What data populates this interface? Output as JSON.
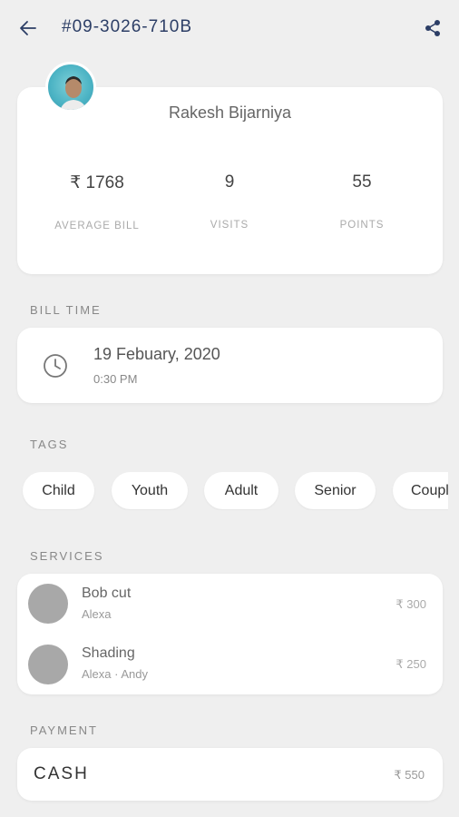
{
  "header": {
    "order_id": "#09-3026-710B"
  },
  "customer": {
    "name": "Rakesh Bijarniya",
    "stats": [
      {
        "value": "₹ 1768",
        "label": "AVERAGE BILL"
      },
      {
        "value": "9",
        "label": "VISITS"
      },
      {
        "value": "55",
        "label": "POINTS"
      }
    ]
  },
  "bill_time": {
    "section_label": "BILL TIME",
    "date": "19 Febuary, 2020",
    "time": "0:30 PM"
  },
  "tags": {
    "section_label": "TAGS",
    "items": [
      "Child",
      "Youth",
      "Adult",
      "Senior",
      "Couple"
    ]
  },
  "services": {
    "section_label": "SERVICES",
    "items": [
      {
        "name": "Bob cut",
        "staff": "Alexa",
        "price": "₹ 300"
      },
      {
        "name": "Shading",
        "staff": "Alexa · Andy",
        "price": "₹ 250"
      }
    ]
  },
  "payment": {
    "section_label": "PAYMENT",
    "method": "CASH",
    "amount": "₹ 550"
  },
  "colors": {
    "background": "#efefef",
    "accent": "#2c3e66",
    "card": "#ffffff"
  }
}
